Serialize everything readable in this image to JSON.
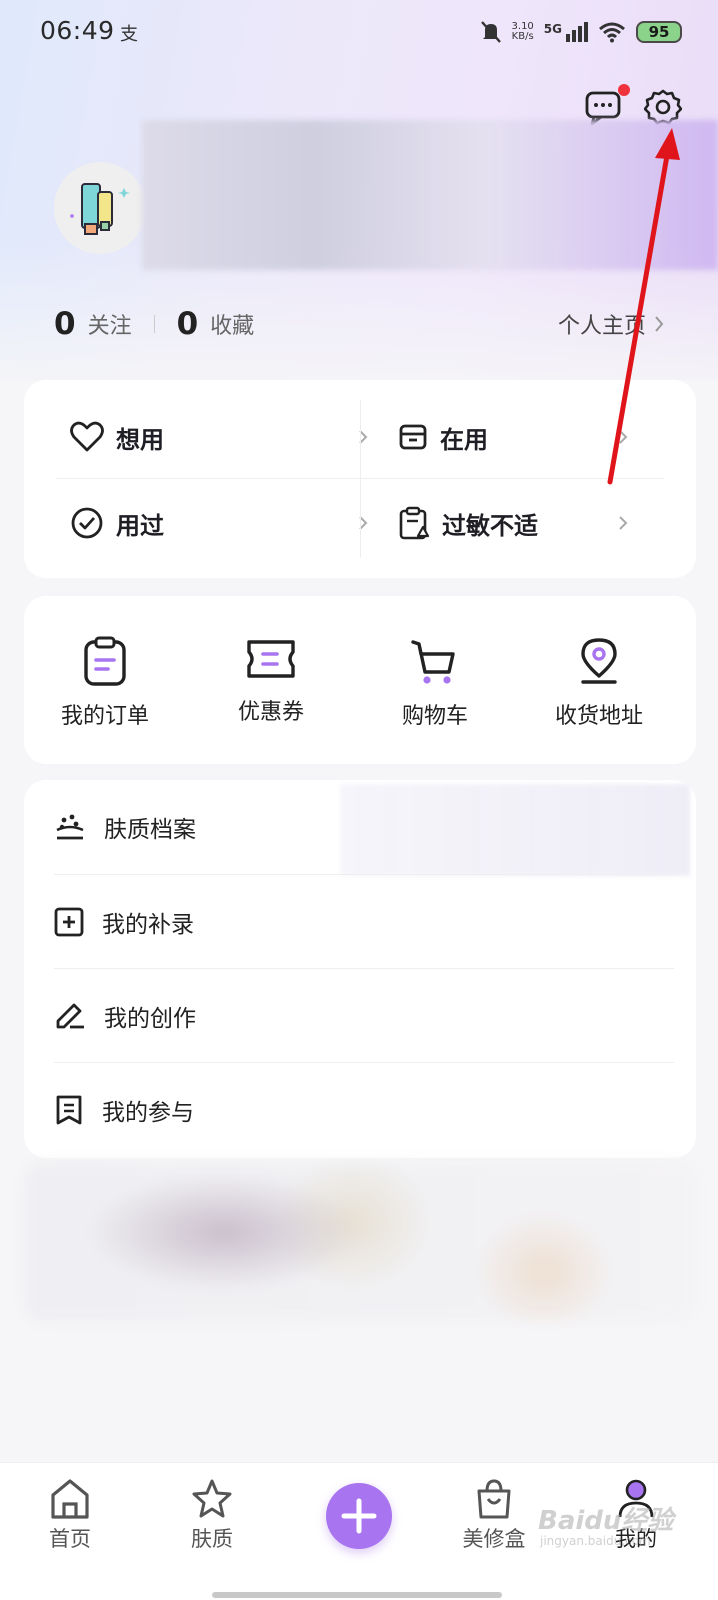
{
  "status_bar": {
    "time": "06:49",
    "extra": "支",
    "net_speed_value": "3.10",
    "net_speed_unit": "KB/s",
    "network": "5G",
    "battery": "95"
  },
  "header": {
    "message_icon": "message-icon",
    "settings_icon": "gear-icon",
    "has_unread": true
  },
  "profile": {
    "stats": [
      {
        "value": "0",
        "label": "关注"
      },
      {
        "value": "0",
        "label": "收藏"
      }
    ],
    "homepage_label": "个人主页"
  },
  "product_status": [
    {
      "label": "想用",
      "icon": "heart-icon"
    },
    {
      "label": "在用",
      "icon": "box-icon"
    },
    {
      "label": "用过",
      "icon": "check-circle-icon"
    },
    {
      "label": "过敏不适",
      "icon": "clipboard-alert-icon"
    }
  ],
  "shortcuts": [
    {
      "label": "我的订单",
      "icon": "order-clipboard-icon"
    },
    {
      "label": "优惠券",
      "icon": "coupon-icon"
    },
    {
      "label": "购物车",
      "icon": "cart-icon"
    },
    {
      "label": "收货地址",
      "icon": "location-pin-icon"
    }
  ],
  "menu": [
    {
      "label": "肤质档案",
      "icon": "skin-profile-icon"
    },
    {
      "label": "我的补录",
      "icon": "plus-square-icon"
    },
    {
      "label": "我的创作",
      "icon": "pencil-icon"
    },
    {
      "label": "我的参与",
      "icon": "bookmark-doc-icon"
    }
  ],
  "bottom_nav": [
    {
      "label": "首页",
      "icon": "home-icon"
    },
    {
      "label": "肤质",
      "icon": "star-outline-icon"
    },
    {
      "label": "",
      "icon": "plus-icon"
    },
    {
      "label": "美修盒",
      "icon": "shopping-bag-icon"
    },
    {
      "label": "我的",
      "icon": "user-icon",
      "active": true
    }
  ],
  "watermark": {
    "text": "Baidu经验",
    "sub": "jingyan.baidu.com"
  },
  "colors": {
    "accent": "#a874f0",
    "annotation_arrow": "#e0151b",
    "unread_dot": "#f0323c"
  }
}
